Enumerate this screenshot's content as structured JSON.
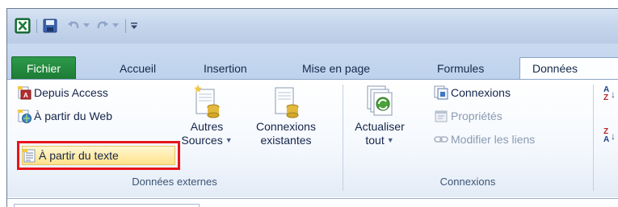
{
  "quick_access": {
    "icons": [
      "excel-logo-icon",
      "save-icon",
      "undo-icon",
      "redo-icon",
      "customize-qat-icon"
    ]
  },
  "tabs": [
    "Fichier",
    "Accueil",
    "Insertion",
    "Mise en page",
    "Formules",
    "Données"
  ],
  "active_tab": "Données",
  "groups": {
    "external_data": {
      "label": "Données externes",
      "from_access": "Depuis Access",
      "from_web": "À partir du Web",
      "from_text": "À partir du texte",
      "other_sources_line1": "Autres",
      "other_sources_line2": "Sources",
      "existing_connections_line1": "Connexions",
      "existing_connections_line2": "existantes"
    },
    "connections": {
      "label": "Connexions",
      "refresh_line1": "Actualiser",
      "refresh_line2": "tout",
      "connections": "Connexions",
      "properties": "Propriétés",
      "edit_links": "Modifier les liens"
    },
    "sort": {
      "az_top": "A",
      "az_bottom": "Z",
      "za_top": "Z",
      "za_bottom": "A"
    }
  },
  "colors": {
    "file_tab": "#1f7d37",
    "highlight_border": "#e8141a",
    "hover_fill": "#ffe28a"
  }
}
